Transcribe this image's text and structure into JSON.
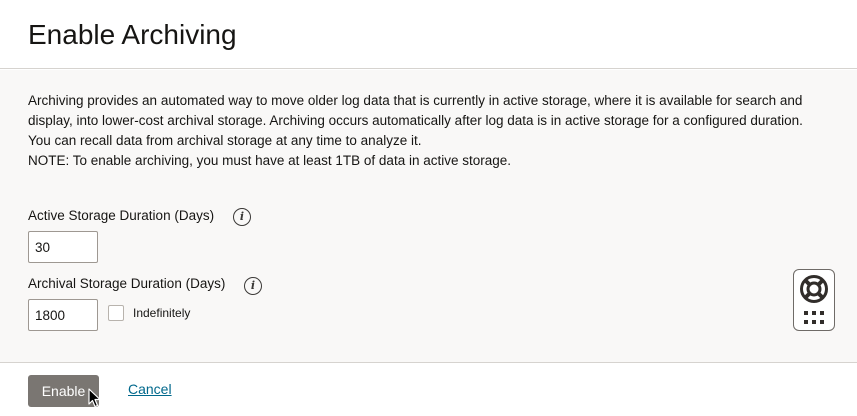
{
  "dialog": {
    "title": "Enable Archiving",
    "description": "Archiving provides an automated way to move older log data that is currently in active storage, where it is available for search and display, into lower-cost archival storage. Archiving occurs automatically after log data is in active storage for a configured duration. You can recall data from archival storage at any time to analyze it.",
    "note": "NOTE: To enable archiving, you must have at least 1TB of data in active storage."
  },
  "form": {
    "active_label": "Active Storage Duration (Days)",
    "active_value": "30",
    "archival_label": "Archival Storage Duration (Days)",
    "archival_value": "1800",
    "indefinitely_label": "Indefinitely",
    "indefinitely_checked": false,
    "info_glyph": "i"
  },
  "footer": {
    "enable_label": "Enable",
    "cancel_label": "Cancel"
  },
  "icons": {
    "info": "info-icon",
    "help": "lifebuoy-icon",
    "apps": "grid-icon"
  },
  "colors": {
    "primary_button": "#7a7672",
    "link": "#00688c",
    "body_bg": "#f9f8f7"
  }
}
